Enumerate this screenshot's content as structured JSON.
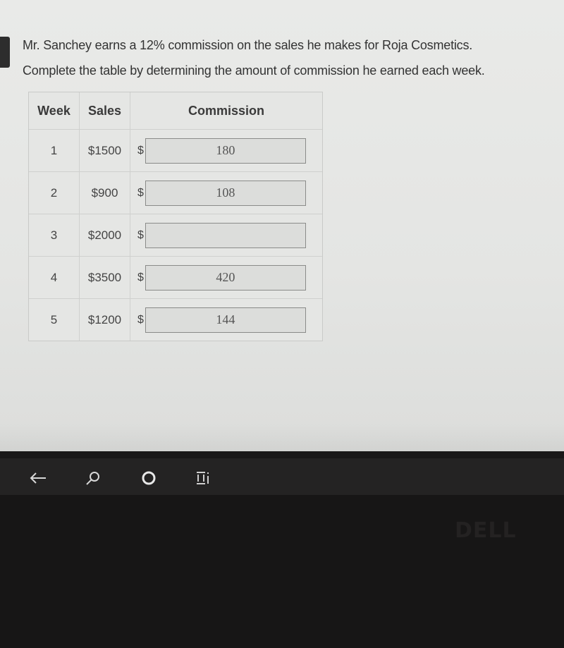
{
  "question": {
    "line1": "Mr. Sanchey earns a 12% commission on the sales he makes for Roja Cosmetics.",
    "line2": "Complete the table by determining the amount of commission he earned each week."
  },
  "table": {
    "headers": {
      "week": "Week",
      "sales": "Sales",
      "commission": "Commission"
    },
    "currency_symbol": "$",
    "rows": [
      {
        "week": "1",
        "sales": "$1500",
        "commission": "180"
      },
      {
        "week": "2",
        "sales": "$900",
        "commission": "108"
      },
      {
        "week": "3",
        "sales": "$2000",
        "commission": ""
      },
      {
        "week": "4",
        "sales": "$3500",
        "commission": "420"
      },
      {
        "week": "5",
        "sales": "$1200",
        "commission": "144"
      }
    ]
  },
  "taskbar": {
    "icons": [
      "back-arrow-icon",
      "search-icon",
      "home-circle-icon",
      "task-view-icon"
    ]
  },
  "device": {
    "logo": "DELL"
  }
}
